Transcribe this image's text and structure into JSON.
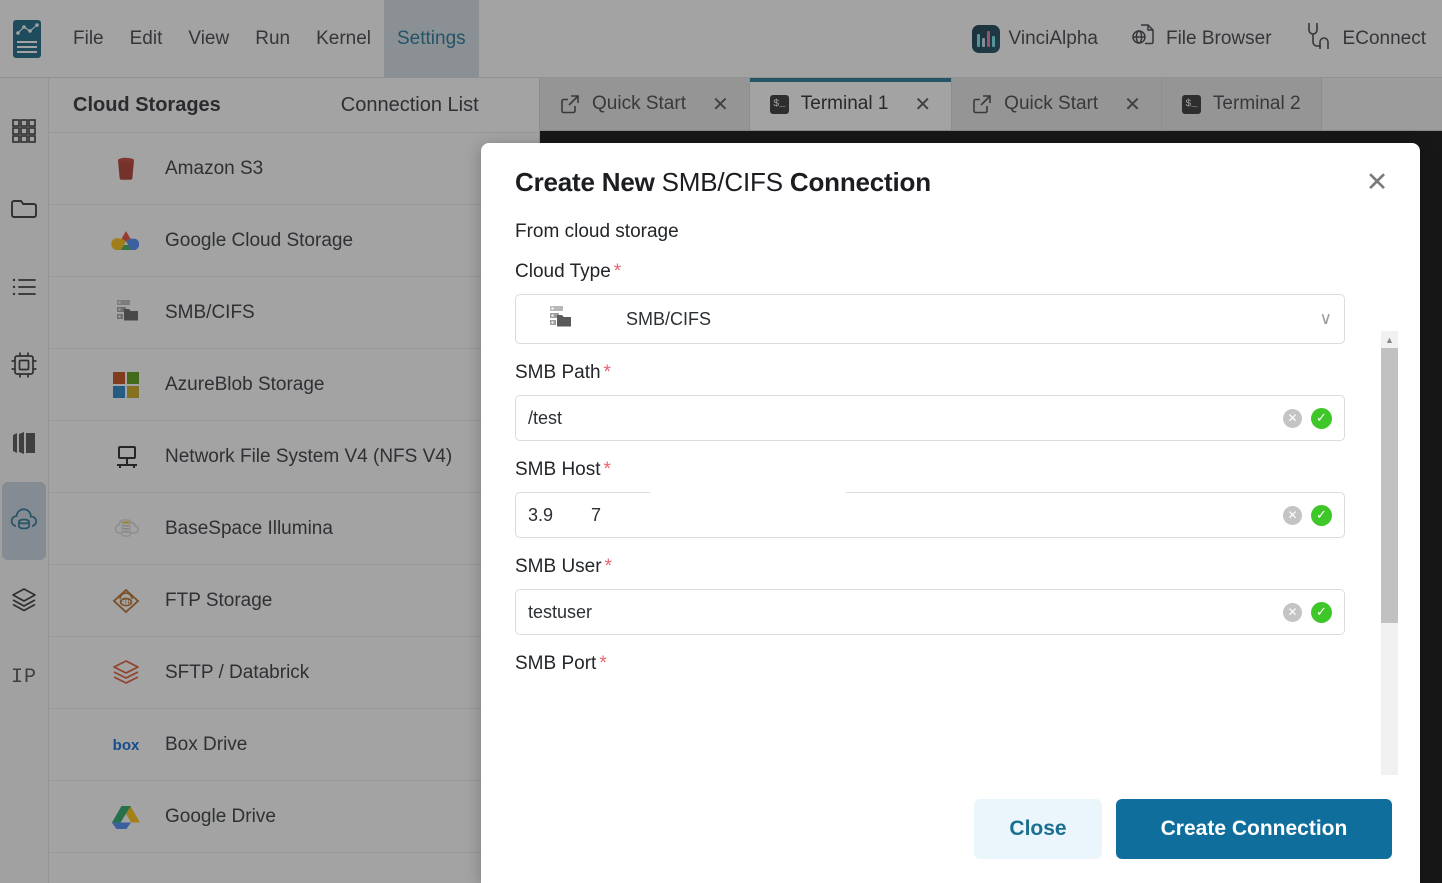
{
  "menubar": {
    "logo_icon": "jupyter-notebook-logo",
    "items": [
      {
        "label": "File",
        "active": false
      },
      {
        "label": "Edit",
        "active": false
      },
      {
        "label": "View",
        "active": false
      },
      {
        "label": "Run",
        "active": false
      },
      {
        "label": "Kernel",
        "active": false
      },
      {
        "label": "Settings",
        "active": true
      }
    ],
    "right_items": [
      {
        "label": "VinciAlpha",
        "icon": "vincialpha-logo-icon"
      },
      {
        "label": "File Browser",
        "icon": "globe-file-icon"
      },
      {
        "label": "EConnect",
        "icon": "plug-connector-icon"
      }
    ]
  },
  "rail": {
    "items": [
      {
        "name": "grid-icon",
        "active": false
      },
      {
        "name": "folder-icon",
        "active": false
      },
      {
        "name": "list-icon",
        "active": false
      },
      {
        "name": "chip-icon",
        "active": false
      },
      {
        "name": "stack-cards-icon",
        "active": false
      },
      {
        "name": "cloud-database-icon",
        "active": true
      },
      {
        "name": "layers-icon",
        "active": false
      },
      {
        "name": "ip-label",
        "active": false,
        "text": "IP"
      }
    ]
  },
  "left_panel": {
    "title": "Cloud Storages",
    "tab_label": "Connection List",
    "storages": [
      {
        "label": "Amazon S3",
        "icon": "amazon-s3-icon"
      },
      {
        "label": "Google Cloud Storage",
        "icon": "google-cloud-storage-icon"
      },
      {
        "label": "SMB/CIFS",
        "icon": "smb-cifs-icon"
      },
      {
        "label": "AzureBlob Storage",
        "icon": "azure-blob-icon"
      },
      {
        "label": "Network File System V4 (NFS V4)",
        "icon": "nfs-icon"
      },
      {
        "label": "BaseSpace Illumina",
        "icon": "basespace-illumina-icon"
      },
      {
        "label": "FTP Storage",
        "icon": "ftp-storage-icon"
      },
      {
        "label": "SFTP / Databrick",
        "icon": "sftp-databricks-icon"
      },
      {
        "label": "Box Drive",
        "icon": "box-drive-icon"
      },
      {
        "label": "Google Drive",
        "icon": "google-drive-icon"
      }
    ]
  },
  "tabs": [
    {
      "label": "Quick Start",
      "icon": "external-link-icon",
      "closable": true,
      "active": false
    },
    {
      "label": "Terminal 1",
      "icon": "terminal-icon",
      "closable": true,
      "active": true
    },
    {
      "label": "Quick Start",
      "icon": "external-link-icon",
      "closable": true,
      "active": false
    },
    {
      "label": "Terminal 2",
      "icon": "terminal-icon",
      "closable": false,
      "active": false
    }
  ],
  "tab_close_glyph": "✕",
  "modal": {
    "title_prefix": "Create New",
    "title_middle": "SMB/CIFS",
    "title_suffix": "Connection",
    "close_glyph": "✕",
    "subtitle": "From cloud storage",
    "fields": [
      {
        "label": "Cloud Type",
        "required": true,
        "type": "select",
        "value": "SMB/CIFS",
        "icon": "smb-cifs-icon",
        "chevron": "∨"
      },
      {
        "label": "SMB Path",
        "required": true,
        "type": "text",
        "value": "/test",
        "clear_glyph": "✕",
        "valid_glyph": "✓"
      },
      {
        "label": "SMB Host",
        "required": true,
        "type": "text",
        "value_part_a": "3.9",
        "value_part_b": "7",
        "redacted": true,
        "clear_glyph": "✕",
        "valid_glyph": "✓"
      },
      {
        "label": "SMB User",
        "required": true,
        "type": "text",
        "value": "testuser",
        "clear_glyph": "✕",
        "valid_glyph": "✓"
      },
      {
        "label": "SMB Port",
        "required": true,
        "type": "text",
        "value": "",
        "cutoff": true
      }
    ],
    "required_marker": "*",
    "scrollbar": {
      "up_glyph": "▲",
      "down_glyph": "▼"
    },
    "buttons": {
      "close": "Close",
      "create": "Create Connection"
    }
  },
  "colors": {
    "accent": "#0f6e9b",
    "accent_soft": "#eaf6fb",
    "required_red": "#e8636f",
    "valid_green": "#3ec728",
    "tab_active_border": "#1b6f92",
    "menu_active_bg": "#d4dce5"
  }
}
